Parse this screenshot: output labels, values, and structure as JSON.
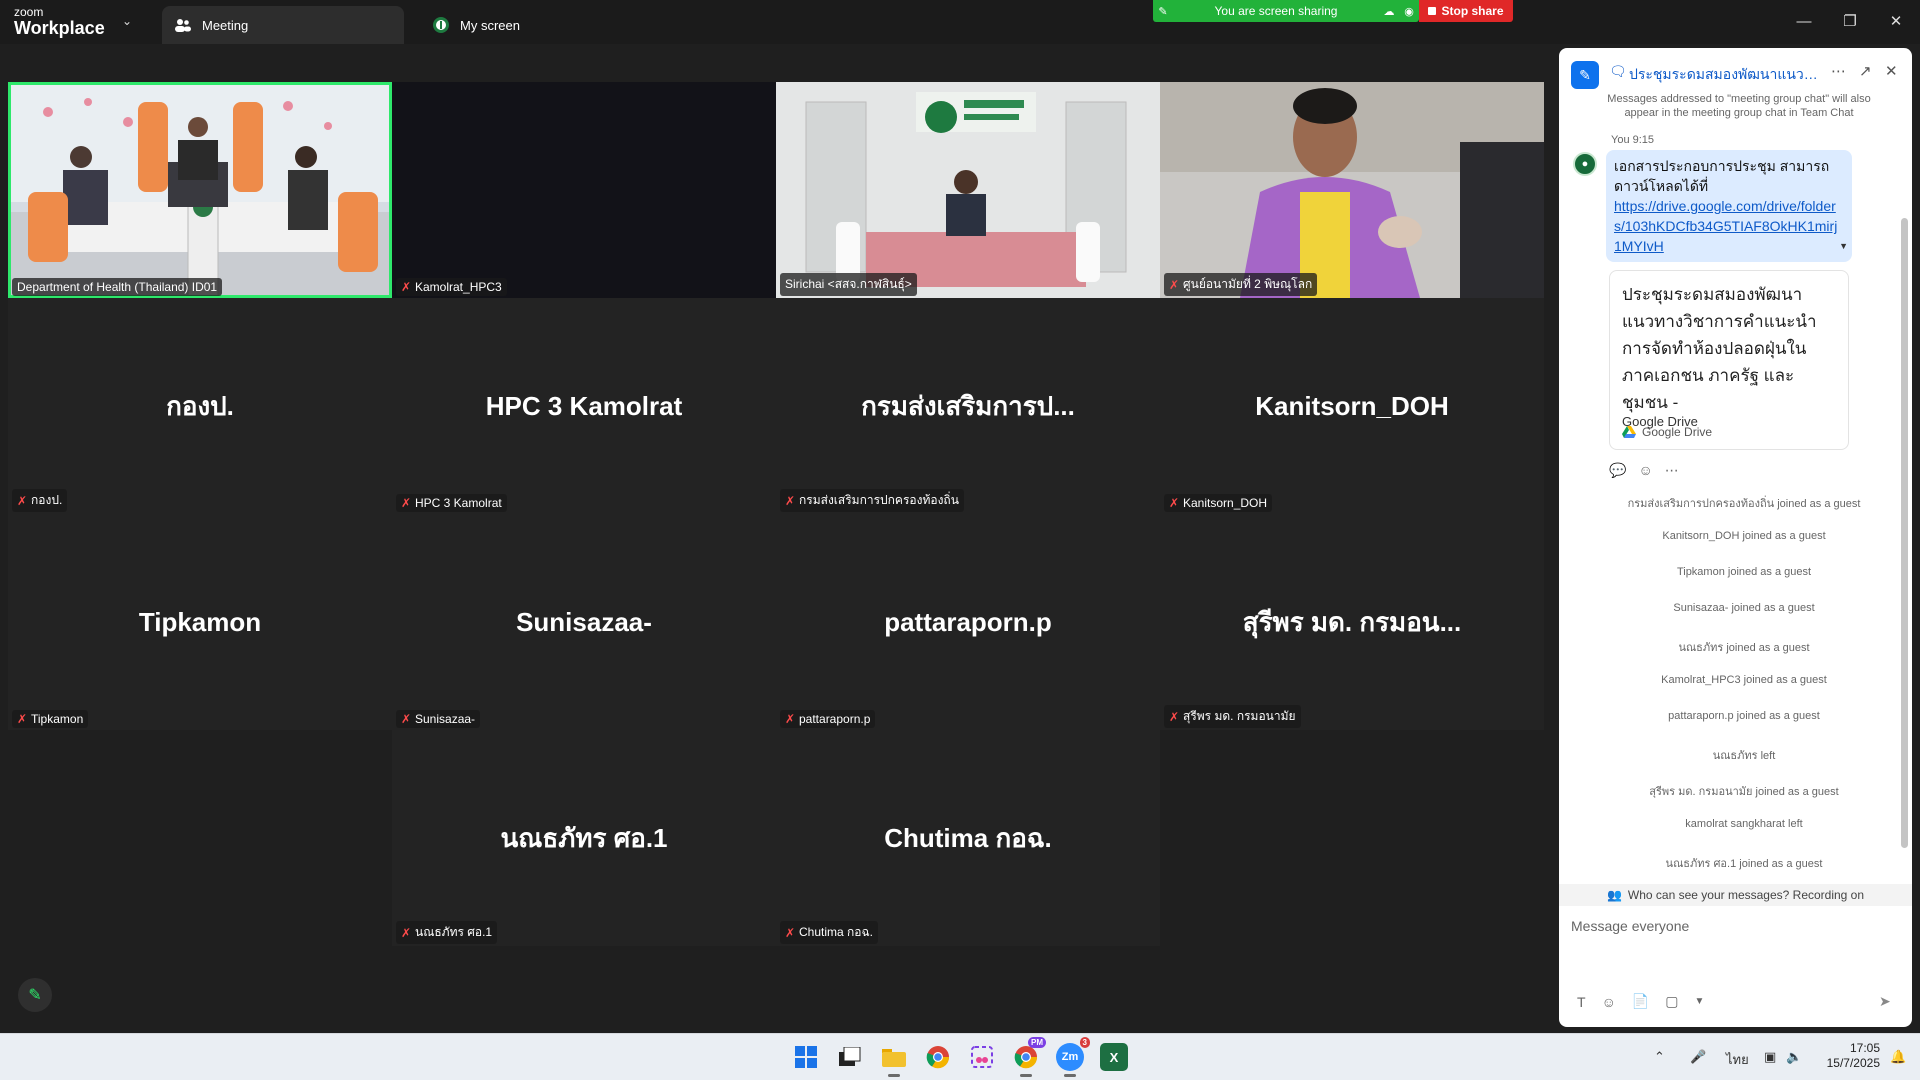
{
  "app": {
    "brand_small": "zoom",
    "brand_large": "Workplace"
  },
  "tabs": {
    "meeting": "Meeting",
    "my_screen": "My screen"
  },
  "share": {
    "status": "You are screen sharing",
    "stop": "Stop share"
  },
  "tiles": [
    {
      "big": "",
      "name": "Department of Health (Thailand) ID01",
      "muted": false
    },
    {
      "big": "",
      "name": "Kamolrat_HPC3",
      "muted": true
    },
    {
      "big": "",
      "name": "Sirichai  <สสจ.กาฬสินธุ์>",
      "muted": false
    },
    {
      "big": "",
      "name": "ศูนย์อนามัยที่ 2 พิษณุโลก",
      "muted": true
    },
    {
      "big": "กองป.",
      "name": "กองป.",
      "muted": true
    },
    {
      "big": "HPC 3 Kamolrat",
      "name": "HPC 3 Kamolrat",
      "muted": true
    },
    {
      "big": "กรมส่งเสริมการป...",
      "name": "กรมส่งเสริมการปกครองท้องถิ่น",
      "muted": true
    },
    {
      "big": "Kanitsorn_DOH",
      "name": "Kanitsorn_DOH",
      "muted": true
    },
    {
      "big": "Tipkamon",
      "name": "Tipkamon",
      "muted": true
    },
    {
      "big": "Sunisazaa-",
      "name": "Sunisazaa-",
      "muted": true
    },
    {
      "big": "pattaraporn.p",
      "name": "pattaraporn.p",
      "muted": true
    },
    {
      "big": "สุรีพร มด. กรมอน...",
      "name": "สุรีพร มด. กรมอนามัย",
      "muted": true
    },
    {
      "big": "นณธภัทร ศอ.1",
      "name": "นณธภัทร ศอ.1",
      "muted": true
    },
    {
      "big": "Chutima กอฉ.",
      "name": "Chutima กอฉ.",
      "muted": true
    }
  ],
  "chat": {
    "title": "ประชุมระดมสมองพัฒนาแนวทาง...",
    "notice": "Messages addressed to \"meeting group chat\" will also appear in the meeting group chat in Team Chat",
    "message": {
      "sender_time": "You 9:15",
      "text": "เอกสารประกอบการประชุม สามารถดาวน์โหลดได้ที่",
      "link": "https://drive.google.com/drive/folders/103hKDCfb34G5TIAF8OkHK1mirj1MYIvH"
    },
    "card": {
      "title": "ประชุมระดมสมองพัฒนาแนวทางวิชาการคำแนะนำการจัดทำห้องปลอดฝุ่นในภาคเอกชน ภาครัฐ และชุมชน -",
      "subtitle": "Google Drive",
      "source": "Google Drive"
    },
    "system": [
      "กรมส่งเสริมการปกครองท้องถิ่น joined as a guest",
      "Kanitsorn_DOH joined as a guest",
      "Tipkamon joined as a guest",
      "Sunisazaa- joined as a guest",
      "นณธภัทร joined as a guest",
      "Kamolrat_HPC3 joined as a guest",
      "pattaraporn.p joined as a guest",
      "นณธภัทร left",
      "สุรีพร มด. กรมอนามัย joined as a guest",
      "kamolrat sangkharat left",
      "นณธภัทร ศอ.1 joined as a guest"
    ],
    "who_can_see": "Who can see your messages? Recording on",
    "input_placeholder": "Message everyone"
  },
  "taskbar": {
    "apps": [
      {
        "name": "windows-start",
        "color": "#1a73e8",
        "label": ""
      },
      {
        "name": "task-view",
        "color": "#333333",
        "label": ""
      },
      {
        "name": "file-explorer",
        "color": "#f2b705",
        "label": ""
      },
      {
        "name": "chrome",
        "color": "#db4437",
        "label": ""
      },
      {
        "name": "snipping-tool",
        "color": "#7b3fe4",
        "label": ""
      },
      {
        "name": "chrome-profile",
        "color": "#0f9d58",
        "label": "",
        "badge": "PM"
      },
      {
        "name": "zoom",
        "color": "#2d8cff",
        "label": "Zm",
        "badge": "3"
      },
      {
        "name": "excel",
        "color": "#1d6f42",
        "label": "X"
      }
    ],
    "lang": "ไทย",
    "time": "17:05",
    "date": "15/7/2025"
  },
  "colors": {
    "accent": "#0e72ed",
    "share_green": "#22b23a",
    "stop_red": "#e02828",
    "speaking": "#2ee86b"
  }
}
